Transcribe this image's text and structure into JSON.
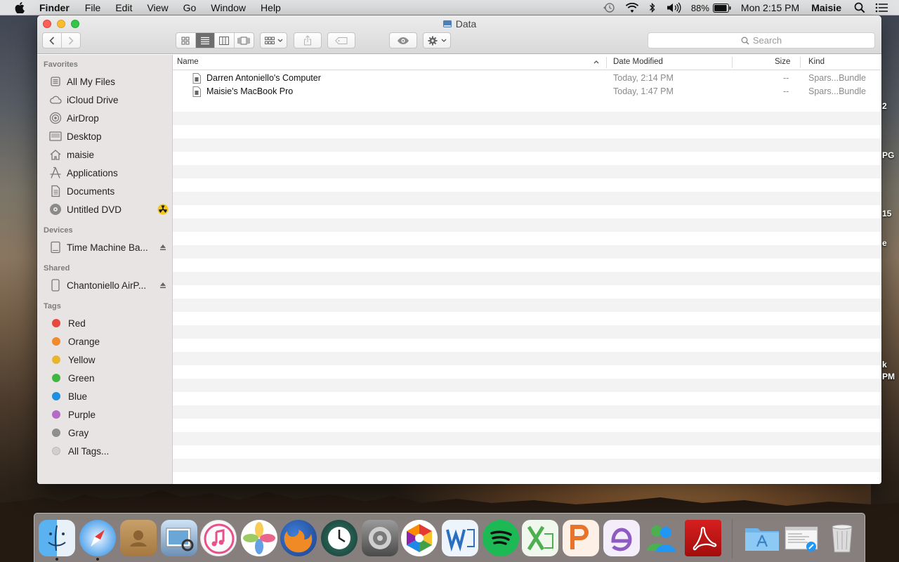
{
  "menubar": {
    "app": "Finder",
    "menus": [
      "File",
      "Edit",
      "View",
      "Go",
      "Window",
      "Help"
    ],
    "battery": "88%",
    "clock": "Mon 2:15 PM",
    "user": "Maisie"
  },
  "window": {
    "title": "Data",
    "search_placeholder": "Search"
  },
  "sidebar": {
    "favorites_title": "Favorites",
    "favorites": [
      {
        "label": "All My Files",
        "icon": "all-files-icon"
      },
      {
        "label": "iCloud Drive",
        "icon": "cloud-icon"
      },
      {
        "label": "AirDrop",
        "icon": "airdrop-icon"
      },
      {
        "label": "Desktop",
        "icon": "desktop-icon"
      },
      {
        "label": "maisie",
        "icon": "home-icon"
      },
      {
        "label": "Applications",
        "icon": "applications-icon"
      },
      {
        "label": "Documents",
        "icon": "documents-icon"
      },
      {
        "label": "Untitled DVD",
        "icon": "dvd-icon"
      }
    ],
    "devices_title": "Devices",
    "devices": [
      {
        "label": "Time Machine Ba...",
        "icon": "drive-icon"
      }
    ],
    "shared_title": "Shared",
    "shared": [
      {
        "label": "Chantoniello AirP...",
        "icon": "airport-icon"
      }
    ],
    "tags_title": "Tags",
    "tags": [
      {
        "label": "Red",
        "color": "#e8473f"
      },
      {
        "label": "Orange",
        "color": "#f08a2c"
      },
      {
        "label": "Yellow",
        "color": "#e8b52e"
      },
      {
        "label": "Green",
        "color": "#3fb641"
      },
      {
        "label": "Blue",
        "color": "#1f8fe0"
      },
      {
        "label": "Purple",
        "color": "#b46ac7"
      },
      {
        "label": "Gray",
        "color": "#8e8e8e"
      },
      {
        "label": "All Tags...",
        "color": "#d0d0d0"
      }
    ]
  },
  "list": {
    "columns": {
      "name": "Name",
      "date": "Date Modified",
      "size": "Size",
      "kind": "Kind"
    },
    "rows": [
      {
        "name": "Darren Antoniello's Computer",
        "date": "Today, 2:14 PM",
        "size": "--",
        "kind": "Spars...Bundle"
      },
      {
        "name": "Maisie's MacBook Pro",
        "date": "Today, 1:47 PM",
        "size": "--",
        "kind": "Spars...Bundle"
      }
    ]
  },
  "desktop_peek": [
    "2",
    "PG",
    "15",
    "e",
    "k",
    "PM"
  ],
  "dock": {
    "apps": [
      "finder-icon",
      "safari-icon",
      "contacts-icon",
      "preview-icon",
      "itunes-icon",
      "photos-icon",
      "firefox-icon",
      "time-machine-icon",
      "system-preferences-icon",
      "picasa-icon",
      "word-icon",
      "spotify-icon",
      "excel-icon",
      "powerpoint-icon",
      "entourage-icon",
      "messenger-icon",
      "acrobat-icon"
    ],
    "stacks": [
      "applications-folder-icon",
      "downloads-stack-icon",
      "trash-icon"
    ]
  }
}
